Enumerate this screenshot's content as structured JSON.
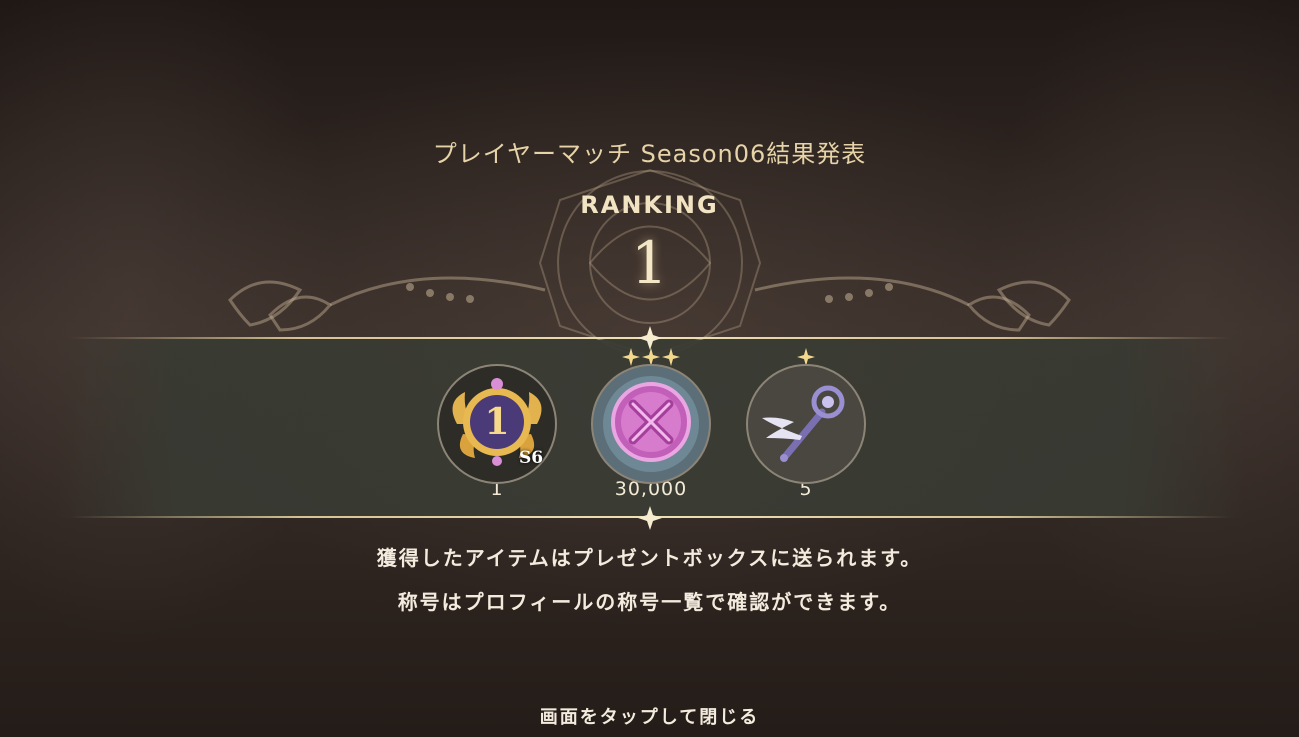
{
  "header": {
    "title": "プレイヤーマッチ Season06結果発表",
    "ranking_label": "RANKING",
    "ranking_value": "1"
  },
  "rewards": [
    {
      "icon": "rank-1-title-badge-icon",
      "badge": "S6",
      "count": "1",
      "stars": 0
    },
    {
      "icon": "pink-crossed-swords-medal-icon",
      "count": "30,000",
      "stars": 3
    },
    {
      "icon": "winged-staff-icon",
      "count": "5",
      "stars": 1
    }
  ],
  "notices": [
    "獲得したアイテムはプレゼントボックスに送られます。",
    "称号はプロフィールの称号一覧で確認ができます。"
  ],
  "close_hint": "画面をタップして閉じる",
  "colors": {
    "accent_gold": "#e6d3a8",
    "band": "#3a3c34",
    "text_light": "#f3ecde"
  }
}
